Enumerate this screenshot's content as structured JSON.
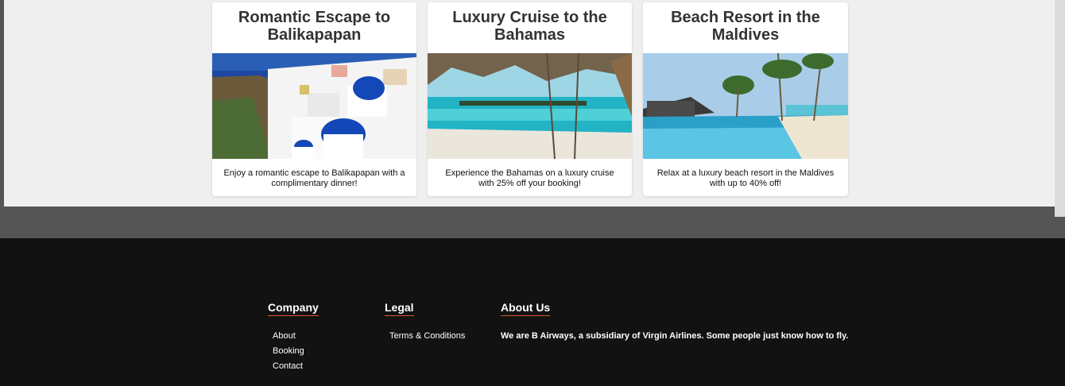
{
  "cards": [
    {
      "title": "Romantic Escape to Balikapapan",
      "description": "Enjoy a romantic escape to Balikapapan with a complimentary dinner!"
    },
    {
      "title": "Luxury Cruise to the Bahamas",
      "description": "Experience the Bahamas on a luxury cruise with 25% off your booking!"
    },
    {
      "title": "Beach Resort in the Maldives",
      "description": "Relax at a luxury beach resort in the Maldives with up to 40% off!"
    }
  ],
  "footer": {
    "company": {
      "heading": "Company",
      "links": [
        "About",
        "Booking",
        "Contact"
      ]
    },
    "legal": {
      "heading": "Legal",
      "links": [
        "Terms & Conditions"
      ]
    },
    "about": {
      "heading": "About Us",
      "text": "We are B Airways, a subsidiary of Virgin Airlines. Some people just know how to fly."
    }
  },
  "colors": {
    "footer_bg": "#121212",
    "accent": "#e0562a",
    "panel_bg": "#efefef"
  }
}
